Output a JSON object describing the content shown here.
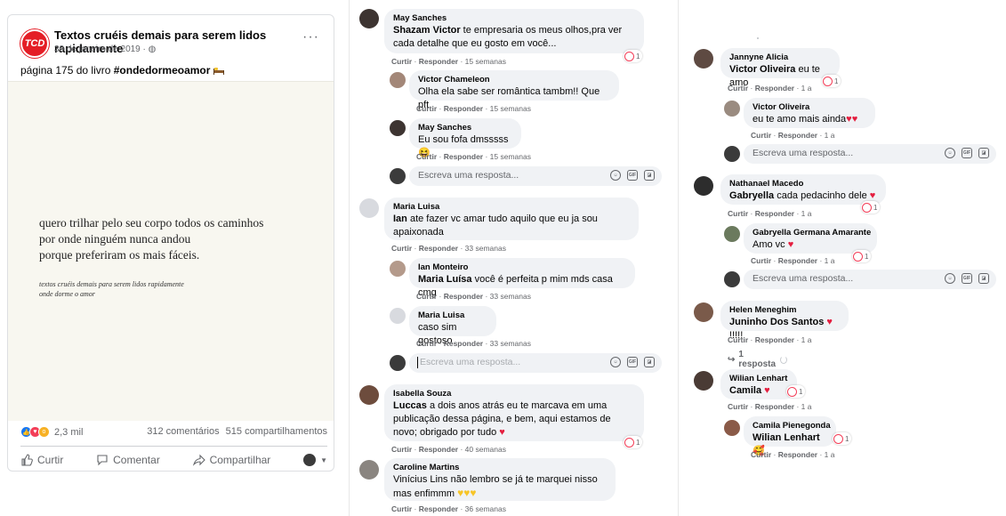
{
  "post": {
    "page_name": "Textos cruéis demais para serem lidos rapidamente",
    "logo_text": "TCD",
    "date": "30 de janeiro de 2019 · ",
    "more": "···",
    "caption_prefix": "página 175 do livro ",
    "caption_tag": "#ondedormeoamor",
    "poem": "quero trilhar pelo seu corpo todos os caminhos\npor onde ninguém nunca andou\nporque preferiram os mais fáceis.",
    "credit": "textos cruéis demais para serem lidos rapidamente\nonde dorme o amor",
    "reaction_count": "2,3 mil",
    "comments_count": "312 comentários",
    "shares_count": "515 compartilhamentos",
    "actions": {
      "like": "Curtir",
      "comment": "Comentar",
      "share": "Compartilhar"
    }
  },
  "labels": {
    "like": "Curtir",
    "reply": "Responder",
    "dot": " · ",
    "reply_placeholder": "Escreva uma resposta...",
    "gif": "GIF",
    "one_reply": "1 resposta"
  },
  "colors": {
    "brand": "#e41e26",
    "facebook_blue": "#1877f2",
    "bubble_bg": "#f0f2f5",
    "meta_text": "#65676b",
    "love_red": "#f33e58"
  },
  "column2": {
    "c1": {
      "author": "May Sanches",
      "mention": "Shazam Victor",
      "text": " te empresaria os meus olhos,pra ver cada detalhe que eu gosto em você...",
      "time": "15 semanas",
      "reactions": "1"
    },
    "c1r1": {
      "author": "Victor Chameleon",
      "text": "Olha ela sabe ser romântica tambm!! Que pft",
      "time": "15 semanas"
    },
    "c1r2": {
      "author": "May Sanches",
      "text": "Eu sou fofa dmsssss 😆",
      "time": "15 semanas"
    },
    "c2": {
      "author": "Maria Luisa",
      "mention": "Ian",
      "text": " ate fazer vc amar tudo aquilo que eu ja sou apaixonada",
      "time": "33 semanas"
    },
    "c2r1": {
      "author": "Ian Monteiro",
      "mention": "Maria Luísa",
      "text": " você é perfeita p mim mds casa cmg",
      "time": "33 semanas"
    },
    "c2r2": {
      "author": "Maria Luisa",
      "text": "caso sim gostoso",
      "time": "33 semanas"
    },
    "c3": {
      "author": "Isabella Souza",
      "mention": "Luccas",
      "text": " a dois anos atrás eu te marcava em uma publicação dessa página, e bem, aqui estamos de novo; obrigado por tudo",
      "time": "40 semanas",
      "reactions": "1"
    },
    "c4": {
      "author": "Caroline Martins",
      "text": "Vinícius Lins não lembro se já te marquei nisso mas enfimmm",
      "time": "36 semanas"
    }
  },
  "column3": {
    "c1": {
      "author": "Jannyne Alicia",
      "mention": "Victor Oliveira",
      "text": " eu te amo",
      "time": "1 a",
      "reactions": "1"
    },
    "c1r1": {
      "author": "Victor Oliveira",
      "text": "eu te amo mais ainda",
      "time": "1 a"
    },
    "c2": {
      "author": "Nathanael Macedo",
      "mention": "Gabryella",
      "text": " cada pedacinho dele",
      "time": "1 a",
      "reactions": "1"
    },
    "c2r1": {
      "author": "Gabryella Germana Amarante",
      "text": "Amo vc",
      "time": "1 a",
      "reactions": "1"
    },
    "c3": {
      "author": "Helen Meneghim",
      "mention": "Juninho Dos Santos",
      "text": " !!!!!",
      "time": "1 a"
    },
    "c4": {
      "author": "Wilian Lenhart",
      "mention": "Camila",
      "text": "",
      "time": "1 a",
      "reactions": "1"
    },
    "c4r1": {
      "author": "Camila Pienegonda",
      "mention": "Wilian Lenhart",
      "text": " 🥰",
      "time": "1 a",
      "reactions": "1"
    }
  }
}
